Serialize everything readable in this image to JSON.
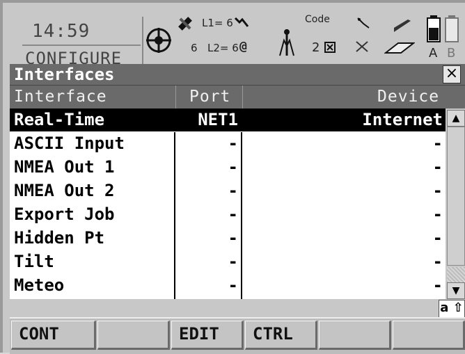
{
  "status": {
    "time": "14:59",
    "mode": "CONFIGURE",
    "l1": "L1= 6",
    "l2": "L2= 6",
    "sat_count": "6",
    "code_label": "Code",
    "code_num": "2",
    "battery_a": "A",
    "battery_b": "B"
  },
  "panel": {
    "title": "Interfaces",
    "close": "×"
  },
  "columns": {
    "interface": "Interface",
    "port": "Port",
    "device": "Device"
  },
  "rows": [
    {
      "interface": "Real-Time",
      "port": "NET1",
      "device": "Internet"
    },
    {
      "interface": "ASCII Input",
      "port": "-",
      "device": "-"
    },
    {
      "interface": "NMEA Out 1",
      "port": "-",
      "device": "-"
    },
    {
      "interface": "NMEA Out 2",
      "port": "-",
      "device": "-"
    },
    {
      "interface": "Export Job",
      "port": "-",
      "device": "-"
    },
    {
      "interface": "Hidden Pt",
      "port": "-",
      "device": "-"
    },
    {
      "interface": "Tilt",
      "port": "-",
      "device": "-"
    },
    {
      "interface": "Meteo",
      "port": "-",
      "device": "-"
    }
  ],
  "input_mode": "a ⇧",
  "fkeys": [
    "CONT",
    "",
    "EDIT",
    "CTRL",
    "",
    ""
  ]
}
